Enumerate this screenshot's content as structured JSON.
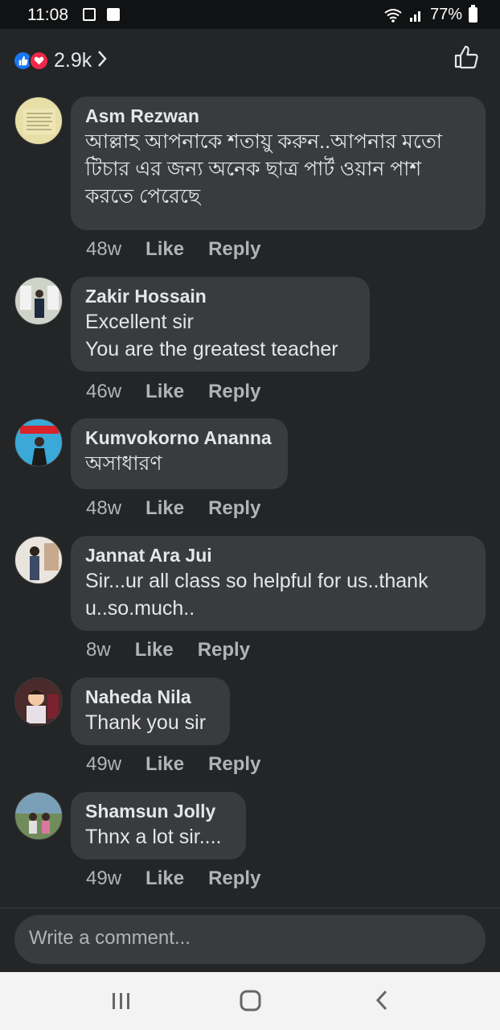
{
  "status_bar": {
    "time": "11:08",
    "battery": "77%"
  },
  "header": {
    "reaction_count": "2.9k"
  },
  "comments": [
    {
      "author": "Asm Rezwan",
      "text": "আল্লাহ আপনাকে শতায়ু করুন..আপনার মতো\nটিচার এর জন্য অনেক ছাত্র পার্ট ওয়ান পাশ\nকরতে পেরেছে",
      "time": "48w",
      "like": "Like",
      "reply": "Reply"
    },
    {
      "author": "Zakir Hossain",
      "text": "Excellent sir\nYou are the greatest teacher",
      "time": "46w",
      "like": "Like",
      "reply": "Reply"
    },
    {
      "author": "Kumvokorno Ananna",
      "text": "অসাধারণ",
      "time": "48w",
      "like": "Like",
      "reply": "Reply"
    },
    {
      "author": "Jannat Ara Jui",
      "text": "Sir...ur all class so helpful for us..thank\nu..so.much..",
      "time": "8w",
      "like": "Like",
      "reply": "Reply"
    },
    {
      "author": "Naheda Nila",
      "text": "Thank you sir",
      "time": "49w",
      "like": "Like",
      "reply": "Reply"
    },
    {
      "author": "Shamsun Jolly",
      "text": "Thnx a lot sir....",
      "time": "49w",
      "like": "Like",
      "reply": "Reply"
    }
  ],
  "composer": {
    "placeholder": "Write a comment..."
  }
}
